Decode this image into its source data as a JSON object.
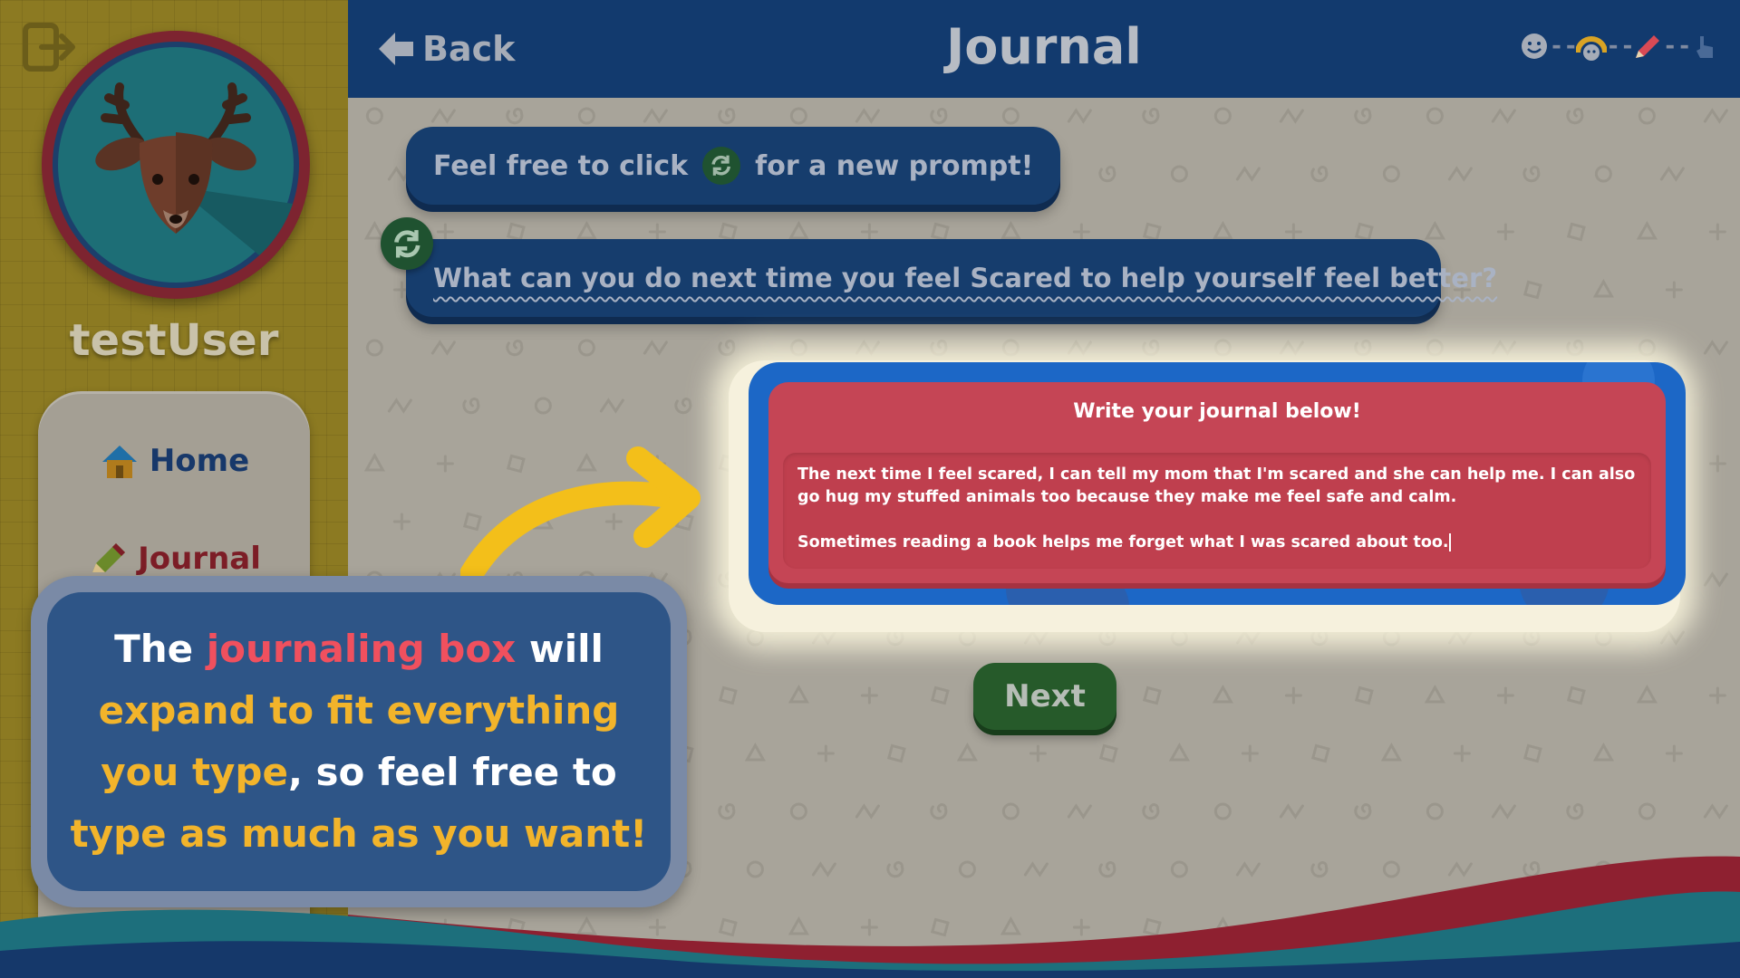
{
  "sidebar": {
    "username": "testUser",
    "nav": {
      "home": "Home",
      "journal": "Journal"
    }
  },
  "header": {
    "back_label": "Back",
    "title": "Journal",
    "progress_steps": [
      "smiley-icon",
      "rainbow-face-icon",
      "pencil-icon",
      "pointer-icon"
    ]
  },
  "prompt": {
    "hint_before": "Feel free to click",
    "hint_after": "for a new prompt!",
    "question": "What can you do next time you feel Scared to help yourself feel better?"
  },
  "journal": {
    "label": "Write your journal below!",
    "text": "The next time I feel scared, I can tell my mom that I'm scared and she can help me. I can also go hug my stuffed animals too because they make me feel safe and calm.\n\nSometimes reading a book helps me forget what I was scared about too."
  },
  "next_label": "Next",
  "tutorial": {
    "t1": "The ",
    "t2": "journaling box",
    "t3": " will",
    "t4": "expand to fit everything",
    "t5": "you type",
    "t6": ", so feel free to",
    "t7": "type as much as you want!"
  },
  "colors": {
    "header": "#123a6e",
    "sidebar": "#8c7a22",
    "journal_outer": "#1c67c6",
    "journal_inner": "#c54555",
    "next_button": "#265a2a",
    "highlight_red": "#f0505e",
    "highlight_yellow": "#f2b42b"
  }
}
